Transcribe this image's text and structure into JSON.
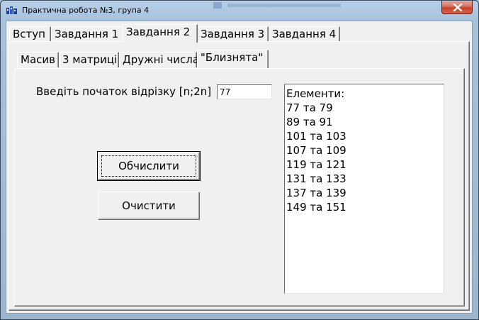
{
  "window": {
    "title": "Практична робота №3, група 4"
  },
  "outer_tabs": [
    {
      "label": "Вступ"
    },
    {
      "label": "Завдання 1"
    },
    {
      "label": "Завдання 2"
    },
    {
      "label": "Завдання 3"
    },
    {
      "label": "Завдання 4"
    }
  ],
  "outer_active_tab": "Завдання 2",
  "inner_tabs": [
    {
      "label": "Масив"
    },
    {
      "label": "3 матриці"
    },
    {
      "label": "Дружні числа"
    },
    {
      "label": "\"Близнята\""
    }
  ],
  "inner_active_tab": "\"Близнята\"",
  "form": {
    "prompt_label": "Введіть початок відрізку [n;2n]",
    "start_value": "77",
    "calculate_label": "Обчислити",
    "clear_label": "Очистити"
  },
  "results": {
    "lines": [
      "Елементи:",
      "77 та 79",
      "89 та 91",
      "101 та 103",
      "107 та 109",
      "119 та 121",
      "131 та 133",
      "137 та 139",
      "149 та 151"
    ]
  },
  "icons": {
    "app": "app-icon",
    "close": "close-icon"
  },
  "colors": {
    "titlebar": "#a7c2dd",
    "close_button": "#c7412a",
    "face": "#f0f0f0"
  }
}
